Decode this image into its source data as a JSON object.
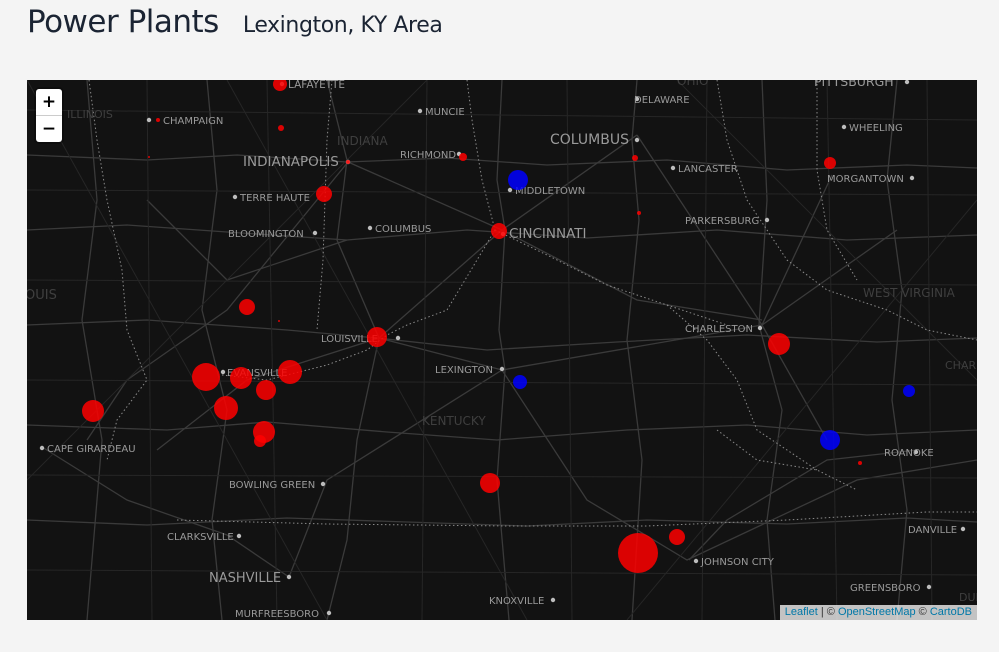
{
  "header": {
    "title": "Power Plants",
    "subtitle": "Lexington, KY Area"
  },
  "map": {
    "zoom_in_label": "+",
    "zoom_out_label": "−",
    "attribution": {
      "leaflet": "Leaflet",
      "sep1": " | © ",
      "osm": "OpenStreetMap",
      "sep2": " © ",
      "carto": "CartoDB"
    },
    "colors": {
      "background": "#121212",
      "roads": "#3a3a3a",
      "borders": "#8a8a8a",
      "labels": "#9a9a9a",
      "plant_red": "#ff0000",
      "plant_blue": "#0000ff"
    },
    "cities": [
      "LAFAYETTE",
      "CHAMPAIGN",
      "MUNCIE",
      "INDIANAPOLIS",
      "RICHMOND",
      "TERRE HAUTE",
      "BLOOMINGTON",
      "COLUMBUS",
      "COLUMBUS",
      "DELAWARE",
      "LANCASTER",
      "MIDDLETOWN",
      "CINCINNATI",
      "PARKERSBURG",
      "PITTSBURGH",
      "WHEELING",
      "MORGANTOWN",
      "LOUISVILLE",
      "LEXINGTON",
      "CHARLESTON",
      "EVANSVILLE",
      "CAPE GIRARDEAU",
      "BOWLING GREEN",
      "CLARKSVILLE",
      "NASHVILLE",
      "MURFREESBORO",
      "KNOXVILLE",
      "JOHNSON CITY",
      "ROANOKE",
      "DANVILLE",
      "GREENSBORO"
    ],
    "regions": [
      "OHIO",
      "INDIANA",
      "KENTUCKY",
      "WEST VIRGINIA",
      "ILLINOIS",
      "OUIS",
      "CHARL",
      "DUR"
    ],
    "plants": [
      {
        "color": "red",
        "size": 7
      },
      {
        "color": "red",
        "size": 3
      },
      {
        "color": "red",
        "size": 1
      },
      {
        "color": "red",
        "size": 2
      },
      {
        "color": "red",
        "size": 8
      },
      {
        "color": "red",
        "size": 2
      },
      {
        "color": "blue",
        "size": 10
      },
      {
        "color": "red",
        "size": 4
      },
      {
        "color": "red",
        "size": 3
      },
      {
        "color": "red",
        "size": 2
      },
      {
        "color": "red",
        "size": 6
      },
      {
        "color": "red",
        "size": 8
      },
      {
        "color": "red",
        "size": 1
      },
      {
        "color": "red",
        "size": 8
      },
      {
        "color": "red",
        "size": 10
      },
      {
        "color": "red",
        "size": 14
      },
      {
        "color": "red",
        "size": 11
      },
      {
        "color": "red",
        "size": 12
      },
      {
        "color": "red",
        "size": 10
      },
      {
        "color": "red",
        "size": 12
      },
      {
        "color": "red",
        "size": 11
      },
      {
        "color": "red",
        "size": 6
      },
      {
        "color": "red",
        "size": 11
      },
      {
        "color": "blue",
        "size": 7
      },
      {
        "color": "red",
        "size": 11
      },
      {
        "color": "blue",
        "size": 6
      },
      {
        "color": "blue",
        "size": 10
      },
      {
        "color": "red",
        "size": 2
      },
      {
        "color": "red",
        "size": 10
      },
      {
        "color": "red",
        "size": 20
      },
      {
        "color": "red",
        "size": 8
      }
    ]
  }
}
